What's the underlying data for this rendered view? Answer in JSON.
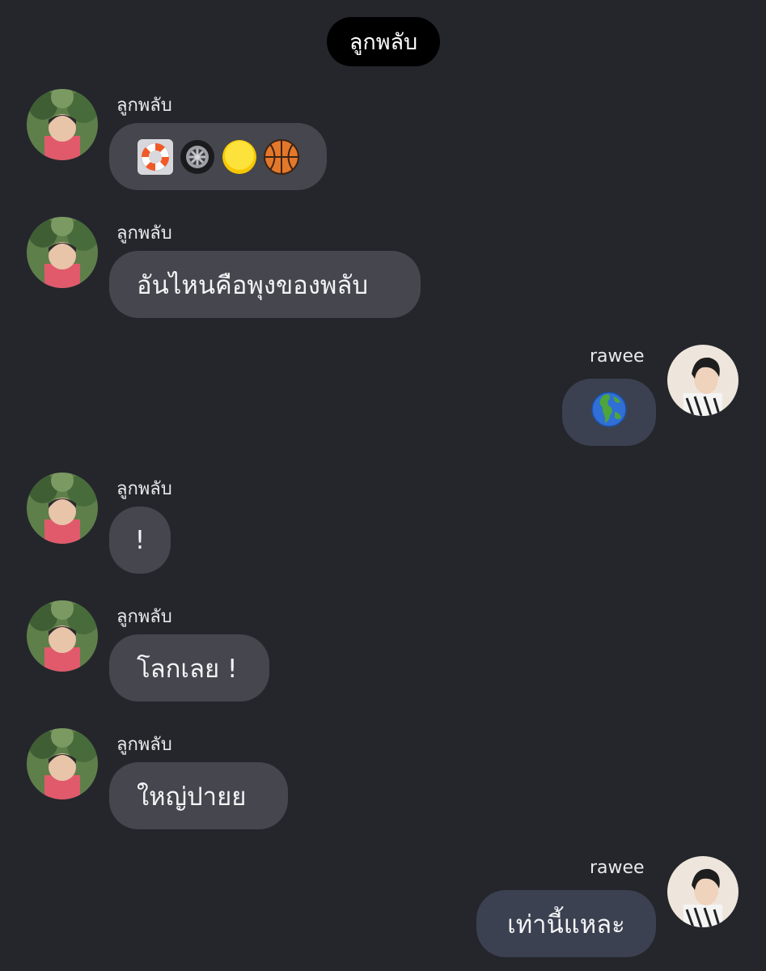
{
  "chat": {
    "title": "ลูกพลับ",
    "messages": [
      {
        "sender": "ลูกพลับ",
        "emojis": [
          "ring-buoy-emoji",
          "wheel-emoji",
          "yellow-circle-emoji",
          "basketball-emoji"
        ]
      },
      {
        "sender": "ลูกพลับ",
        "text": "อันไหนคือพุงของพลับ"
      },
      {
        "sender": "rawee",
        "emojis": [
          "globe-europe-africa-emoji"
        ]
      },
      {
        "sender": "ลูกพลับ",
        "text": "!"
      },
      {
        "sender": "ลูกพลับ",
        "text": "โลกเลย !"
      },
      {
        "sender": "ลูกพลับ",
        "text": "ใหญ่ปายย"
      },
      {
        "sender": "rawee",
        "text": "เท่านี้แหละ"
      }
    ]
  },
  "colors": {
    "background": "#25262c",
    "incoming_bubble": "#45464e",
    "outgoing_bubble": "#3b4150",
    "header_pill": "#000000"
  }
}
